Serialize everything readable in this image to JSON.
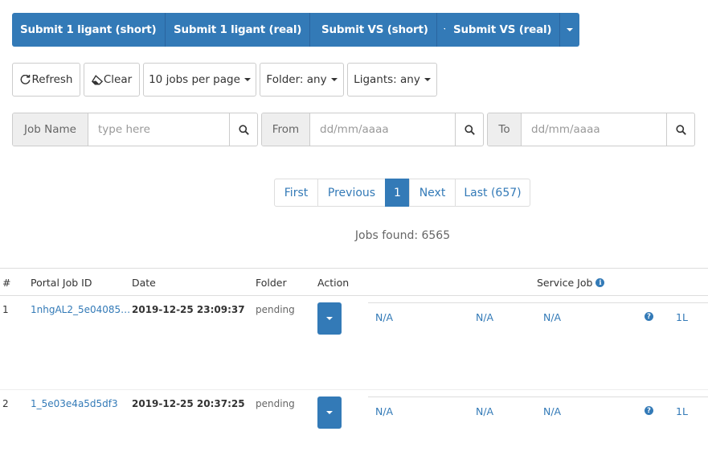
{
  "submit_buttons": [
    {
      "label": "Submit 1 ligant (short)"
    },
    {
      "label": "Submit 1 ligant (real)"
    },
    {
      "label": "Submit VS (short)"
    },
    {
      "label": "Submit VS (real)"
    }
  ],
  "toolbar": {
    "refresh_label": "Refresh",
    "clear_label": "Clear",
    "per_page_label": "10 jobs per page",
    "folder_label": "Folder: any",
    "ligants_label": "Ligants: any"
  },
  "filters": {
    "job_name_label": "Job Name",
    "job_name_placeholder": "type here",
    "from_label": "From",
    "from_placeholder": "dd/mm/aaaa",
    "to_label": "To",
    "to_placeholder": "dd/mm/aaaa"
  },
  "pagination": {
    "first": "First",
    "previous": "Previous",
    "current": "1",
    "next": "Next",
    "last": "Last (657)"
  },
  "jobs_found": "Jobs found: 6565",
  "table": {
    "headers": {
      "num": "#",
      "portal_job_id": "Portal Job ID",
      "date": "Date",
      "folder": "Folder",
      "action": "Action",
      "service_job": "Service Job"
    },
    "rows": [
      {
        "num": "1",
        "portal_job_id": "1nhgAL2_5e04085…",
        "date": "2019-12-25 23:09:37",
        "folder": "pending",
        "na1": "N/A",
        "na2": "N/A",
        "na3": "N/A",
        "lig": "1L"
      },
      {
        "num": "2",
        "portal_job_id": "1_5e03e4a5d5df3",
        "date": "2019-12-25 20:37:25",
        "folder": "pending",
        "na1": "N/A",
        "na2": "N/A",
        "na3": "N/A",
        "lig": "1L"
      }
    ]
  },
  "colors": {
    "primary": "#337ab7",
    "border": "#cccccc"
  }
}
